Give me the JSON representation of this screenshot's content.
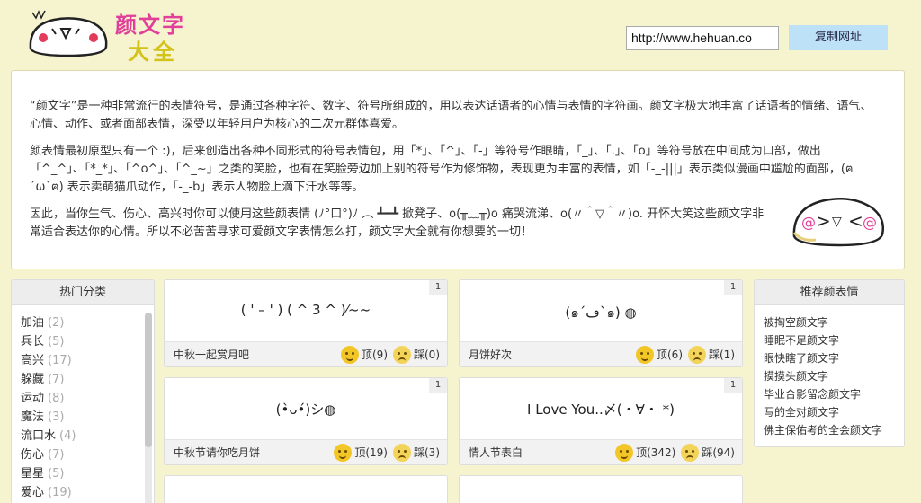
{
  "header": {
    "logo_line1": "颜文字",
    "logo_line2": "大全",
    "url": "http://www.hehuan.co",
    "copy_button": "复制网址"
  },
  "intro": {
    "paragraphs": [
      "“颜文字”是一种非常流行的表情符号，是通过各种字符、数字、符号所组成的，用以表达话语者的心情与表情的字符画。颜文字极大地丰富了话语者的情绪、语气、心情、动作、或者面部表情，深受以年轻用户为核心的二次元群体喜爱。",
      "颜表情最初原型只有一个 :)，后来创造出各种不同形式的符号表情包，用「*」、「^」、「-」等符号作眼睛，「_」、「.」、「o」等符号放在中间成为口部，做出「^_^」、「*_*」、「^o^」、「^_~」之类的笑脸，也有在笑脸旁边加上别的符号作为修饰物，表现更为丰富的表情，如「-_-|||」表示类似漫画中尴尬的面部，(ฅ´ω`ฅ) 表示卖萌猫爪动作，「-_-b」表示人物脸上滴下汗水等等。",
      "因此，当你生气、伤心、高兴时你可以使用这些颜表情 (ﾉ°口°)ﾉ ︵ ┻━┻ 掀凳子、o(╥﹏╥)o 痛哭流涕、o(〃＾▽＾〃)o. 开怀大笑这些颜文字非常适合表达你的心情。所以不必苦苦寻求可爱颜文字表情怎么打，颜文字大全就有你想要的一切！"
    ]
  },
  "sidebar": {
    "title": "热门分类",
    "items": [
      {
        "label": "加油",
        "count": "(2)"
      },
      {
        "label": "兵长",
        "count": "(5)"
      },
      {
        "label": "高兴",
        "count": "(17)"
      },
      {
        "label": "躲藏",
        "count": "(7)"
      },
      {
        "label": "运动",
        "count": "(8)"
      },
      {
        "label": "魔法",
        "count": "(3)"
      },
      {
        "label": "流口水",
        "count": "(4)"
      },
      {
        "label": "伤心",
        "count": "(7)"
      },
      {
        "label": "星星",
        "count": "(5)"
      },
      {
        "label": "爱心",
        "count": "(19)"
      }
    ]
  },
  "cards": [
    {
      "rank": "1",
      "emoticon": "( ' – ' ) ( ^ 3 ^ )⁄~~",
      "title": "中秋一起赏月吧",
      "up_label": "顶(9)",
      "down_label": "踩(0)"
    },
    {
      "rank": "1",
      "emoticon": "(๑´ڡ`๑) ◍",
      "title": "月饼好次",
      "up_label": "顶(6)",
      "down_label": "踩(1)"
    },
    {
      "rank": "1",
      "emoticon": "(•̀ᴗ•́)シ◍",
      "title": "中秋节请你吃月饼",
      "up_label": "顶(19)",
      "down_label": "踩(3)"
    },
    {
      "rank": "1",
      "emoticon": "I Love You..〆(・∀・ *)",
      "title": "情人节表白",
      "up_label": "顶(342)",
      "down_label": "踩(94)"
    }
  ],
  "recommend": {
    "title": "推荐颜表情",
    "items": [
      "被掏空颜文字",
      "睡眠不足颜文字",
      "眼快瞎了颜文字",
      "摸摸头颜文字",
      "毕业合影留念颜文字",
      "写的全对颜文字",
      "佛主保佑考的全会颜文字"
    ]
  },
  "icons": {
    "up_vote": "smile-thumbs-up-icon",
    "down_vote": "sweat-face-icon"
  },
  "colors": {
    "page_bg": "#f6f3cf",
    "logo_pink": "#e0409a",
    "logo_yellow": "#d2c21a",
    "copy_button_bg": "#bde2f7"
  }
}
